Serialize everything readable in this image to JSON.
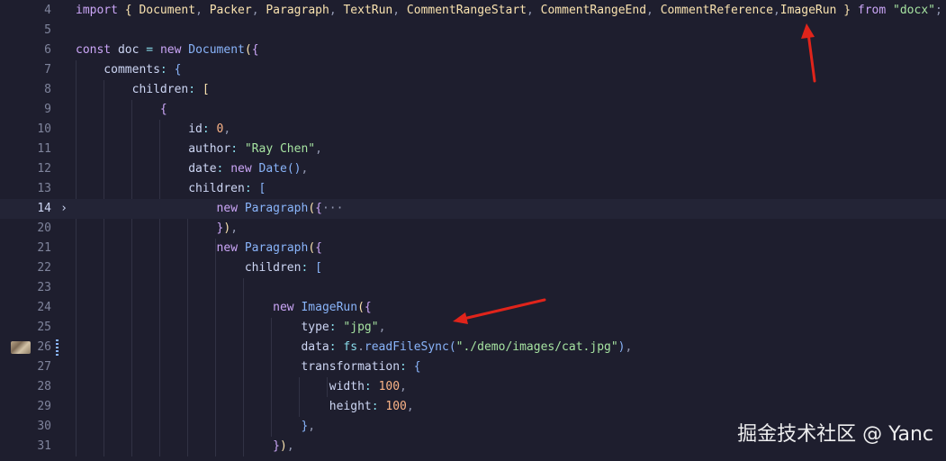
{
  "editor": {
    "lines": [
      {
        "num": "4",
        "tokens": [
          [
            "kw",
            "import"
          ],
          [
            "pr",
            " "
          ],
          [
            "b1",
            "{"
          ],
          [
            "pr",
            " "
          ],
          [
            "ty",
            "Document"
          ],
          [
            "pu",
            ","
          ],
          [
            "pr",
            " "
          ],
          [
            "ty",
            "Packer"
          ],
          [
            "pu",
            ","
          ],
          [
            "pr",
            " "
          ],
          [
            "ty",
            "Paragraph"
          ],
          [
            "pu",
            ","
          ],
          [
            "pr",
            " "
          ],
          [
            "ty",
            "TextRun"
          ],
          [
            "pu",
            ","
          ],
          [
            "pr",
            " "
          ],
          [
            "ty",
            "CommentRangeStart"
          ],
          [
            "pu",
            ","
          ],
          [
            "pr",
            " "
          ],
          [
            "ty",
            "CommentRangeEnd"
          ],
          [
            "pu",
            ","
          ],
          [
            "pr",
            " "
          ],
          [
            "ty",
            "CommentReference"
          ],
          [
            "pu",
            ","
          ],
          [
            "ty",
            "ImageRun"
          ],
          [
            "pr",
            " "
          ],
          [
            "b1",
            "}"
          ],
          [
            "pr",
            " "
          ],
          [
            "kw",
            "from"
          ],
          [
            "pr",
            " "
          ],
          [
            "st",
            "\"docx\""
          ],
          [
            "pu",
            ";"
          ]
        ]
      },
      {
        "num": "5",
        "tokens": []
      },
      {
        "num": "6",
        "tokens": [
          [
            "kw",
            "const"
          ],
          [
            "pr",
            " doc "
          ],
          [
            "op",
            "="
          ],
          [
            "pr",
            " "
          ],
          [
            "kw",
            "new"
          ],
          [
            "pr",
            " "
          ],
          [
            "fn",
            "Document"
          ],
          [
            "b1",
            "("
          ],
          [
            "b2",
            "{"
          ]
        ]
      },
      {
        "num": "7",
        "tokens": [
          [
            "pr",
            "    comments"
          ],
          [
            "op",
            ":"
          ],
          [
            "pr",
            " "
          ],
          [
            "b3",
            "{"
          ]
        ]
      },
      {
        "num": "8",
        "tokens": [
          [
            "pr",
            "        children"
          ],
          [
            "op",
            ":"
          ],
          [
            "pr",
            " "
          ],
          [
            "b1",
            "["
          ]
        ]
      },
      {
        "num": "9",
        "tokens": [
          [
            "pr",
            "            "
          ],
          [
            "b2",
            "{"
          ]
        ]
      },
      {
        "num": "10",
        "tokens": [
          [
            "pr",
            "                id"
          ],
          [
            "op",
            ":"
          ],
          [
            "pr",
            " "
          ],
          [
            "nu",
            "0"
          ],
          [
            "pu",
            ","
          ]
        ]
      },
      {
        "num": "11",
        "tokens": [
          [
            "pr",
            "                author"
          ],
          [
            "op",
            ":"
          ],
          [
            "pr",
            " "
          ],
          [
            "st",
            "\"Ray Chen\""
          ],
          [
            "pu",
            ","
          ]
        ]
      },
      {
        "num": "12",
        "tokens": [
          [
            "pr",
            "                date"
          ],
          [
            "op",
            ":"
          ],
          [
            "pr",
            " "
          ],
          [
            "kw",
            "new"
          ],
          [
            "pr",
            " "
          ],
          [
            "fn",
            "Date"
          ],
          [
            "b3",
            "()"
          ],
          [
            "pu",
            ","
          ]
        ]
      },
      {
        "num": "13",
        "tokens": [
          [
            "pr",
            "                children"
          ],
          [
            "op",
            ":"
          ],
          [
            "pr",
            " "
          ],
          [
            "b3",
            "["
          ]
        ]
      },
      {
        "num": "14",
        "fold": "›",
        "active": true,
        "tokens": [
          [
            "pr",
            "                    "
          ],
          [
            "kw",
            "new"
          ],
          [
            "pr",
            " "
          ],
          [
            "fn",
            "Paragraph"
          ],
          [
            "b1",
            "("
          ],
          [
            "b2",
            "{"
          ],
          [
            "ell",
            "···"
          ]
        ]
      },
      {
        "num": "20",
        "tokens": [
          [
            "pr",
            "                    "
          ],
          [
            "b2",
            "}"
          ],
          [
            "b1",
            ")"
          ],
          [
            "pu",
            ","
          ]
        ]
      },
      {
        "num": "21",
        "tokens": [
          [
            "pr",
            "                    "
          ],
          [
            "kw",
            "new"
          ],
          [
            "pr",
            " "
          ],
          [
            "fn",
            "Paragraph"
          ],
          [
            "b1",
            "("
          ],
          [
            "b2",
            "{"
          ]
        ]
      },
      {
        "num": "22",
        "tokens": [
          [
            "pr",
            "                        children"
          ],
          [
            "op",
            ":"
          ],
          [
            "pr",
            " "
          ],
          [
            "b3",
            "["
          ]
        ]
      },
      {
        "num": "23",
        "tokens": []
      },
      {
        "num": "24",
        "tokens": [
          [
            "pr",
            "                            "
          ],
          [
            "kw",
            "new"
          ],
          [
            "pr",
            " "
          ],
          [
            "fn",
            "ImageRun"
          ],
          [
            "b1",
            "("
          ],
          [
            "b2",
            "{"
          ]
        ]
      },
      {
        "num": "25",
        "tokens": [
          [
            "pr",
            "                                type"
          ],
          [
            "op",
            ":"
          ],
          [
            "pr",
            " "
          ],
          [
            "st",
            "\"jpg\""
          ],
          [
            "pu",
            ","
          ]
        ]
      },
      {
        "num": "26",
        "thumb": true,
        "modified": true,
        "tokens": [
          [
            "pr",
            "                                data"
          ],
          [
            "op",
            ":"
          ],
          [
            "pr",
            " "
          ],
          [
            "op",
            "fs"
          ],
          [
            "pu",
            "."
          ],
          [
            "fn",
            "readFileSync"
          ],
          [
            "b3",
            "("
          ],
          [
            "st",
            "\"./demo/images/cat.jpg\""
          ],
          [
            "b3",
            ")"
          ],
          [
            "pu",
            ","
          ]
        ]
      },
      {
        "num": "27",
        "tokens": [
          [
            "pr",
            "                                transformation"
          ],
          [
            "op",
            ":"
          ],
          [
            "pr",
            " "
          ],
          [
            "b3",
            "{"
          ]
        ]
      },
      {
        "num": "28",
        "tokens": [
          [
            "pr",
            "                                    width"
          ],
          [
            "op",
            ":"
          ],
          [
            "pr",
            " "
          ],
          [
            "nu",
            "100"
          ],
          [
            "pu",
            ","
          ]
        ]
      },
      {
        "num": "29",
        "tokens": [
          [
            "pr",
            "                                    height"
          ],
          [
            "op",
            ":"
          ],
          [
            "pr",
            " "
          ],
          [
            "nu",
            "100"
          ],
          [
            "pu",
            ","
          ]
        ]
      },
      {
        "num": "30",
        "tokens": [
          [
            "pr",
            "                                "
          ],
          [
            "b3",
            "}"
          ],
          [
            "pu",
            ","
          ]
        ]
      },
      {
        "num": "31",
        "tokens": [
          [
            "pr",
            "                            "
          ],
          [
            "b2",
            "}"
          ],
          [
            "b1",
            ")"
          ],
          [
            "pu",
            ","
          ]
        ]
      }
    ]
  },
  "annotation": {
    "arrow_color": "#e0241b"
  },
  "watermark": {
    "text": "掘金技术社区 @ Yanc"
  }
}
